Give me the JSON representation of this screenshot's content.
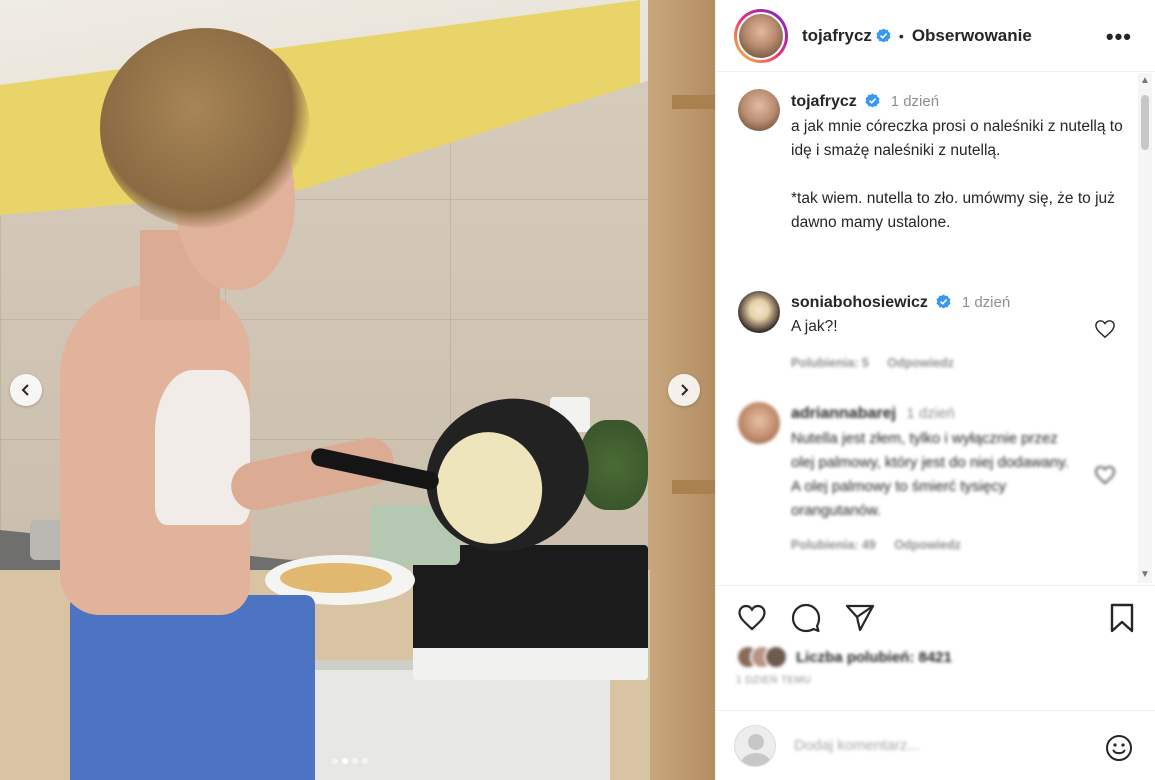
{
  "post": {
    "image_alt": "Kobieta smażąca naleśniki w kuchni",
    "carousel_count": 4,
    "carousel_active": 2
  },
  "header": {
    "username": "tojafrycz",
    "separator": "•",
    "follow_label": "Obserwowanie",
    "more_label": "•••"
  },
  "caption": {
    "username": "tojafrycz",
    "time": "1 dzień",
    "text": "a jak mnie córeczka prosi o naleśniki z nutellą to idę i smażę naleśniki z nutellą.\n\n*tak wiem. nutella to zło. umówmy się, że to już dawno mamy ustalone."
  },
  "comments": [
    {
      "username": "soniabohosiewicz",
      "time": "1 dzień",
      "text": "A jak?!",
      "likes": "Polubienia: 5",
      "reply": "Odpowiedz"
    },
    {
      "username": "adriannabarej",
      "time": "1 dzień",
      "text": "Nutella jest złem, tylko i wyłącznie przez olej palmowy, który jest do niej dodawany. A olej palmowy to śmierć tysięcy orangutanów.",
      "likes": "Polubienia: 49",
      "reply": "Odpowiedz"
    }
  ],
  "footer": {
    "likes_text": "Liczba polubień: 8421",
    "date_text": "1 DZIEŃ TEMU",
    "comment_placeholder": "Dodaj komentarz..."
  },
  "icons": {
    "like": "heart-icon",
    "comment": "comment-icon",
    "share": "share-icon",
    "save": "bookmark-icon",
    "emoji": "emoji-icon",
    "verified": "verified-badge-icon"
  },
  "colors": {
    "verified": "#3897f0",
    "text": "#262626",
    "muted": "#8e8e8e"
  }
}
